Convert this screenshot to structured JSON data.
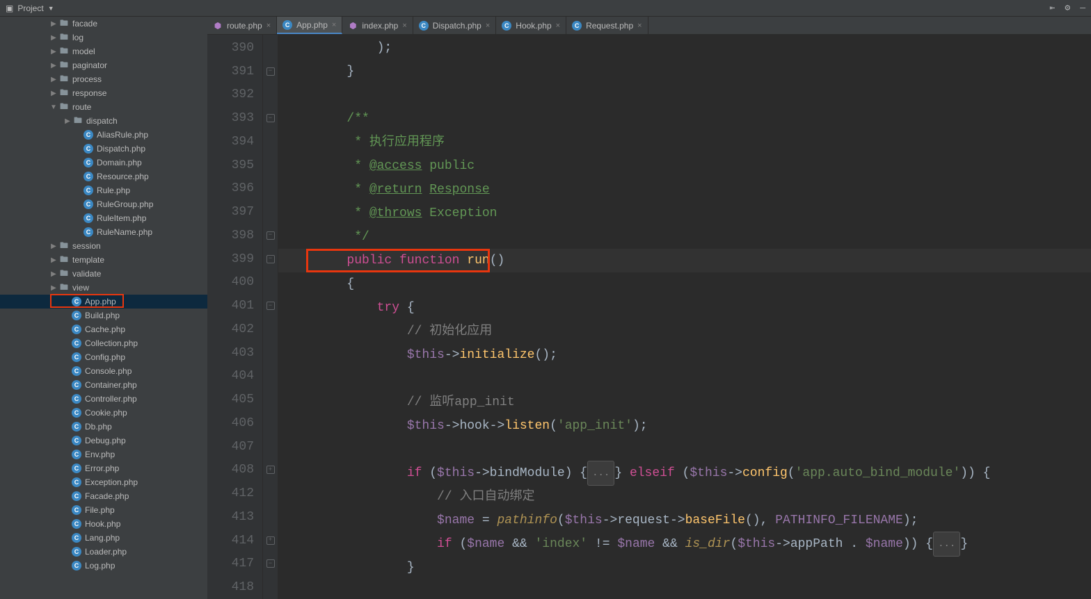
{
  "toolbar": {
    "project_label": "Project"
  },
  "tabs": [
    {
      "label": "route.php",
      "icon": "purple"
    },
    {
      "label": "App.php",
      "icon": "blue",
      "active": true
    },
    {
      "label": "index.php",
      "icon": "purple"
    },
    {
      "label": "Dispatch.php",
      "icon": "blue"
    },
    {
      "label": "Hook.php",
      "icon": "blue"
    },
    {
      "label": "Request.php",
      "icon": "blue"
    }
  ],
  "tree": [
    {
      "indent": 70,
      "type": "folder",
      "label": "facade",
      "arrow": "right"
    },
    {
      "indent": 70,
      "type": "folder",
      "label": "log",
      "arrow": "right"
    },
    {
      "indent": 70,
      "type": "folder",
      "label": "model",
      "arrow": "right"
    },
    {
      "indent": 70,
      "type": "folder",
      "label": "paginator",
      "arrow": "right"
    },
    {
      "indent": 70,
      "type": "folder",
      "label": "process",
      "arrow": "right"
    },
    {
      "indent": 70,
      "type": "folder",
      "label": "response",
      "arrow": "right"
    },
    {
      "indent": 70,
      "type": "folder",
      "label": "route",
      "arrow": "down"
    },
    {
      "indent": 90,
      "type": "folder",
      "label": "dispatch",
      "arrow": "right"
    },
    {
      "indent": 105,
      "type": "file",
      "label": "AliasRule.php"
    },
    {
      "indent": 105,
      "type": "file",
      "label": "Dispatch.php"
    },
    {
      "indent": 105,
      "type": "file",
      "label": "Domain.php"
    },
    {
      "indent": 105,
      "type": "file",
      "label": "Resource.php"
    },
    {
      "indent": 105,
      "type": "file",
      "label": "Rule.php"
    },
    {
      "indent": 105,
      "type": "file",
      "label": "RuleGroup.php"
    },
    {
      "indent": 105,
      "type": "file",
      "label": "RuleItem.php"
    },
    {
      "indent": 105,
      "type": "file",
      "label": "RuleName.php"
    },
    {
      "indent": 70,
      "type": "folder",
      "label": "session",
      "arrow": "right"
    },
    {
      "indent": 70,
      "type": "folder",
      "label": "template",
      "arrow": "right"
    },
    {
      "indent": 70,
      "type": "folder",
      "label": "validate",
      "arrow": "right"
    },
    {
      "indent": 70,
      "type": "folder",
      "label": "view",
      "arrow": "right"
    },
    {
      "indent": 88,
      "type": "file",
      "label": "App.php",
      "selected": true,
      "highlight": true
    },
    {
      "indent": 88,
      "type": "file",
      "label": "Build.php"
    },
    {
      "indent": 88,
      "type": "file",
      "label": "Cache.php"
    },
    {
      "indent": 88,
      "type": "file",
      "label": "Collection.php"
    },
    {
      "indent": 88,
      "type": "file",
      "label": "Config.php"
    },
    {
      "indent": 88,
      "type": "file",
      "label": "Console.php"
    },
    {
      "indent": 88,
      "type": "file",
      "label": "Container.php"
    },
    {
      "indent": 88,
      "type": "file",
      "label": "Controller.php"
    },
    {
      "indent": 88,
      "type": "file",
      "label": "Cookie.php"
    },
    {
      "indent": 88,
      "type": "file",
      "label": "Db.php"
    },
    {
      "indent": 88,
      "type": "file",
      "label": "Debug.php"
    },
    {
      "indent": 88,
      "type": "file",
      "label": "Env.php"
    },
    {
      "indent": 88,
      "type": "file",
      "label": "Error.php"
    },
    {
      "indent": 88,
      "type": "file",
      "label": "Exception.php"
    },
    {
      "indent": 88,
      "type": "file",
      "label": "Facade.php"
    },
    {
      "indent": 88,
      "type": "file",
      "label": "File.php"
    },
    {
      "indent": 88,
      "type": "file",
      "label": "Hook.php"
    },
    {
      "indent": 88,
      "type": "file",
      "label": "Lang.php"
    },
    {
      "indent": 88,
      "type": "file",
      "label": "Loader.php"
    },
    {
      "indent": 88,
      "type": "file",
      "label": "Log.php"
    }
  ],
  "code": {
    "lines": [
      {
        "num": "390",
        "fold": "",
        "tokens": [
          {
            "t": "            ",
            "c": ""
          },
          {
            "t": ");",
            "c": "k-punct"
          }
        ]
      },
      {
        "num": "391",
        "fold": "close",
        "tokens": [
          {
            "t": "        ",
            "c": ""
          },
          {
            "t": "}",
            "c": "k-punct"
          }
        ]
      },
      {
        "num": "392",
        "fold": "",
        "tokens": []
      },
      {
        "num": "393",
        "fold": "close",
        "tokens": [
          {
            "t": "        ",
            "c": ""
          },
          {
            "t": "/**",
            "c": "k-doc"
          }
        ]
      },
      {
        "num": "394",
        "fold": "",
        "tokens": [
          {
            "t": "         ",
            "c": ""
          },
          {
            "t": "* 执行应用程序",
            "c": "k-doc"
          }
        ]
      },
      {
        "num": "395",
        "fold": "",
        "tokens": [
          {
            "t": "         ",
            "c": ""
          },
          {
            "t": "* ",
            "c": "k-doc"
          },
          {
            "t": "@access",
            "c": "k-doc k-under"
          },
          {
            "t": " public",
            "c": "k-doc"
          }
        ]
      },
      {
        "num": "396",
        "fold": "",
        "tokens": [
          {
            "t": "         ",
            "c": ""
          },
          {
            "t": "* ",
            "c": "k-doc"
          },
          {
            "t": "@return",
            "c": "k-doc k-under"
          },
          {
            "t": " ",
            "c": "k-doc"
          },
          {
            "t": "Response",
            "c": "k-doc k-under"
          }
        ]
      },
      {
        "num": "397",
        "fold": "",
        "tokens": [
          {
            "t": "         ",
            "c": ""
          },
          {
            "t": "* ",
            "c": "k-doc"
          },
          {
            "t": "@throws",
            "c": "k-doc k-under"
          },
          {
            "t": " Exception",
            "c": "k-doc"
          }
        ]
      },
      {
        "num": "398",
        "fold": "close",
        "tokens": [
          {
            "t": "         ",
            "c": ""
          },
          {
            "t": "*/",
            "c": "k-doc"
          }
        ]
      },
      {
        "num": "399",
        "fold": "close",
        "current": true,
        "tokens": [
          {
            "t": "        ",
            "c": ""
          },
          {
            "t": "public",
            "c": "k-keyword2"
          },
          {
            "t": " ",
            "c": ""
          },
          {
            "t": "function",
            "c": "k-keyword2"
          },
          {
            "t": " ",
            "c": ""
          },
          {
            "t": "run",
            "c": "k-func"
          },
          {
            "t": "()",
            "c": "k-punct"
          }
        ]
      },
      {
        "num": "400",
        "fold": "",
        "tokens": [
          {
            "t": "        ",
            "c": ""
          },
          {
            "t": "{",
            "c": "k-punct"
          }
        ]
      },
      {
        "num": "401",
        "fold": "close",
        "tokens": [
          {
            "t": "            ",
            "c": ""
          },
          {
            "t": "try",
            "c": "k-keyword2"
          },
          {
            "t": " {",
            "c": "k-punct"
          }
        ]
      },
      {
        "num": "402",
        "fold": "",
        "tokens": [
          {
            "t": "                ",
            "c": ""
          },
          {
            "t": "// 初始化应用",
            "c": "k-comment"
          }
        ]
      },
      {
        "num": "403",
        "fold": "",
        "tokens": [
          {
            "t": "                ",
            "c": ""
          },
          {
            "t": "$this",
            "c": "k-var"
          },
          {
            "t": "->",
            "c": "k-punct"
          },
          {
            "t": "initialize",
            "c": "k-func"
          },
          {
            "t": "();",
            "c": "k-punct"
          }
        ]
      },
      {
        "num": "404",
        "fold": "",
        "tokens": []
      },
      {
        "num": "405",
        "fold": "",
        "tokens": [
          {
            "t": "                ",
            "c": ""
          },
          {
            "t": "// 监听app_init",
            "c": "k-comment"
          }
        ]
      },
      {
        "num": "406",
        "fold": "",
        "tokens": [
          {
            "t": "                ",
            "c": ""
          },
          {
            "t": "$this",
            "c": "k-var"
          },
          {
            "t": "->",
            "c": "k-punct"
          },
          {
            "t": "hook",
            "c": "k-method"
          },
          {
            "t": "->",
            "c": "k-punct"
          },
          {
            "t": "listen",
            "c": "k-func"
          },
          {
            "t": "(",
            "c": "k-punct"
          },
          {
            "t": "'app_init'",
            "c": "k-string"
          },
          {
            "t": ");",
            "c": "k-punct"
          }
        ]
      },
      {
        "num": "407",
        "fold": "",
        "tokens": []
      },
      {
        "num": "408",
        "fold": "plus",
        "tokens": [
          {
            "t": "                ",
            "c": ""
          },
          {
            "t": "if",
            "c": "k-keyword2"
          },
          {
            "t": " (",
            "c": "k-punct"
          },
          {
            "t": "$this",
            "c": "k-var"
          },
          {
            "t": "->",
            "c": "k-punct"
          },
          {
            "t": "bindModule",
            "c": "k-method"
          },
          {
            "t": ") {",
            "c": "k-punct"
          },
          {
            "t": "...",
            "c": "fold-pill"
          },
          {
            "t": "} ",
            "c": "k-punct"
          },
          {
            "t": "elseif",
            "c": "k-keyword2"
          },
          {
            "t": " (",
            "c": "k-punct"
          },
          {
            "t": "$this",
            "c": "k-var"
          },
          {
            "t": "->",
            "c": "k-punct"
          },
          {
            "t": "config",
            "c": "k-func"
          },
          {
            "t": "(",
            "c": "k-punct"
          },
          {
            "t": "'app.auto_bind_module'",
            "c": "k-string"
          },
          {
            "t": ")) {",
            "c": "k-punct"
          }
        ]
      },
      {
        "num": "412",
        "fold": "",
        "tokens": [
          {
            "t": "                    ",
            "c": ""
          },
          {
            "t": "// 入口自动绑定",
            "c": "k-comment"
          }
        ]
      },
      {
        "num": "413",
        "fold": "",
        "tokens": [
          {
            "t": "                    ",
            "c": ""
          },
          {
            "t": "$name",
            "c": "k-var"
          },
          {
            "t": " = ",
            "c": "k-punct"
          },
          {
            "t": "pathinfo",
            "c": "k-funcital"
          },
          {
            "t": "(",
            "c": "k-punct"
          },
          {
            "t": "$this",
            "c": "k-var"
          },
          {
            "t": "->",
            "c": "k-punct"
          },
          {
            "t": "request",
            "c": "k-method"
          },
          {
            "t": "->",
            "c": "k-punct"
          },
          {
            "t": "baseFile",
            "c": "k-func"
          },
          {
            "t": "(), ",
            "c": "k-punct"
          },
          {
            "t": "PATHINFO_FILENAME",
            "c": "k-const"
          },
          {
            "t": ");",
            "c": "k-punct"
          }
        ]
      },
      {
        "num": "414",
        "fold": "plus",
        "tokens": [
          {
            "t": "                    ",
            "c": ""
          },
          {
            "t": "if",
            "c": "k-keyword2"
          },
          {
            "t": " (",
            "c": "k-punct"
          },
          {
            "t": "$name",
            "c": "k-var"
          },
          {
            "t": " && ",
            "c": "k-punct"
          },
          {
            "t": "'index'",
            "c": "k-string"
          },
          {
            "t": " != ",
            "c": "k-punct"
          },
          {
            "t": "$name",
            "c": "k-var"
          },
          {
            "t": " && ",
            "c": "k-punct"
          },
          {
            "t": "is_dir",
            "c": "k-funcital"
          },
          {
            "t": "(",
            "c": "k-punct"
          },
          {
            "t": "$this",
            "c": "k-var"
          },
          {
            "t": "->",
            "c": "k-punct"
          },
          {
            "t": "appPath",
            "c": "k-method"
          },
          {
            "t": " . ",
            "c": "k-punct"
          },
          {
            "t": "$name",
            "c": "k-var"
          },
          {
            "t": ")) {",
            "c": "k-punct"
          },
          {
            "t": "...",
            "c": "fold-pill"
          },
          {
            "t": "}",
            "c": "k-punct"
          }
        ]
      },
      {
        "num": "417",
        "fold": "close",
        "tokens": [
          {
            "t": "                ",
            "c": ""
          },
          {
            "t": "}",
            "c": "k-punct"
          }
        ]
      },
      {
        "num": "418",
        "fold": "",
        "tokens": []
      }
    ]
  }
}
